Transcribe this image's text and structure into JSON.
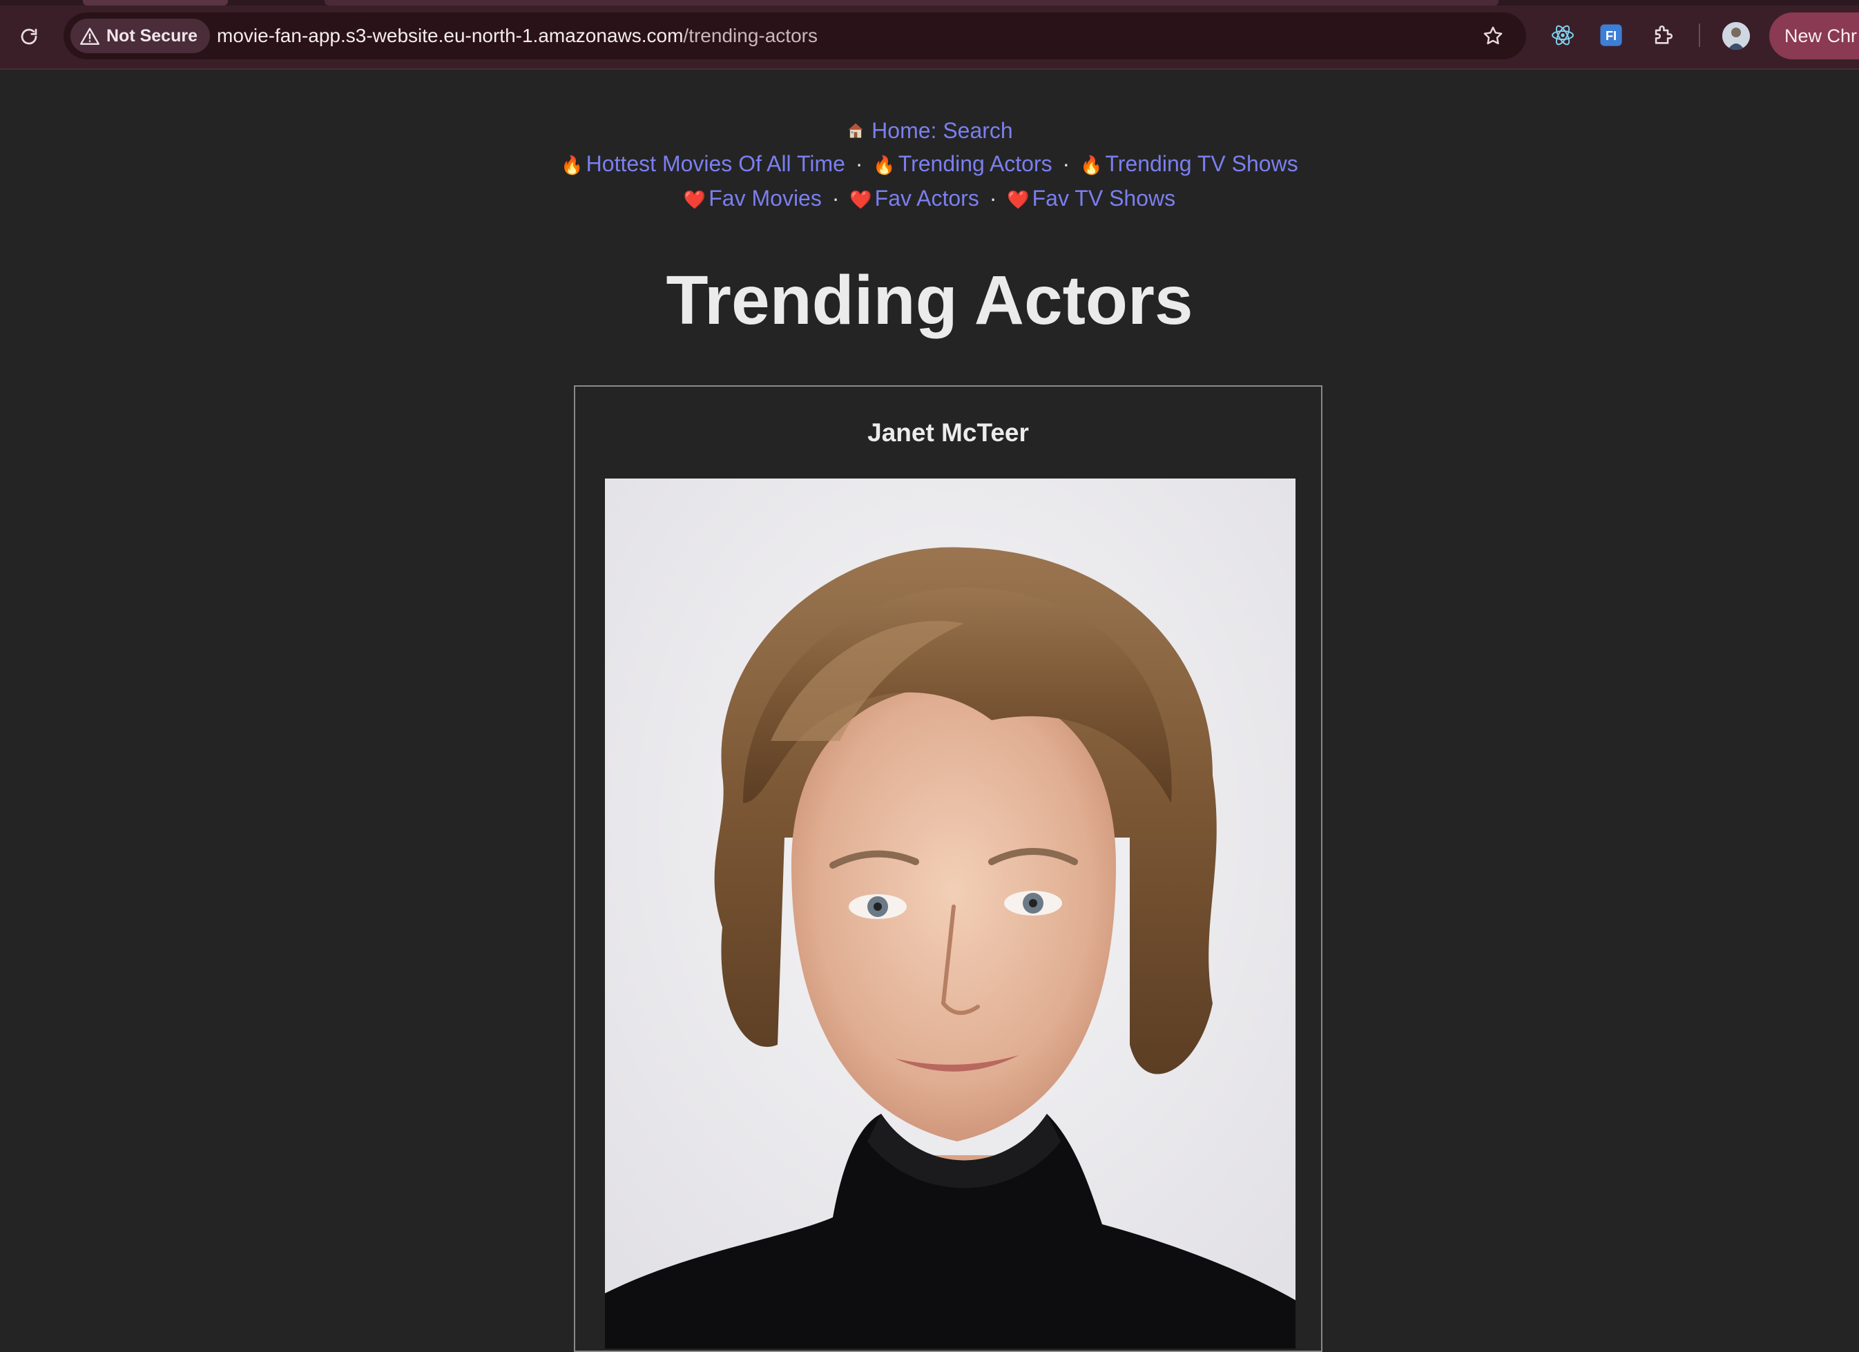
{
  "browser": {
    "security_label": "Not Secure",
    "url_domain": "movie-fan-app.s3-website.eu-north-1.amazonaws.com",
    "url_path": "/trending-actors",
    "new_chrome_label": "New Chr"
  },
  "nav": {
    "home": "Home: Search",
    "hottest_movies": "Hottest Movies Of All Time",
    "trending_actors": "Trending Actors",
    "trending_tv": "Trending TV Shows",
    "fav_movies": "Fav Movies",
    "fav_actors": "Fav Actors",
    "fav_tv": "Fav TV Shows",
    "separator": "·"
  },
  "page": {
    "title": "Trending Actors"
  },
  "actors": [
    {
      "name": "Janet McTeer",
      "photo_icon": "actor-portrait"
    }
  ],
  "colors": {
    "link": "#7b7ff0",
    "background": "#242424",
    "chrome": "#3a1f29"
  }
}
